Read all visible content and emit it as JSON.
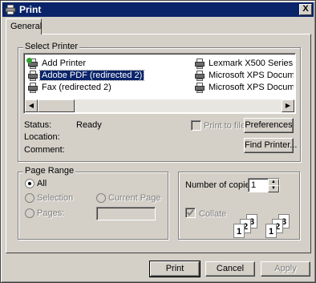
{
  "window": {
    "title": "Print",
    "close_label": "X"
  },
  "tabs": [
    {
      "label": "General"
    }
  ],
  "select_printer": {
    "label": "Select Printer",
    "printers": [
      {
        "name": "Add Printer",
        "icon": "add-printer-icon"
      },
      {
        "name": "Adobe PDF (redirected 2)",
        "icon": "printer-icon",
        "selected": true
      },
      {
        "name": "Fax (redirected 2)",
        "icon": "fax-icon"
      },
      {
        "name": "Lexmark X500 Series",
        "icon": "printer-icon"
      },
      {
        "name": "Microsoft XPS Document W",
        "icon": "printer-icon"
      },
      {
        "name": "Microsoft XPS Document W",
        "icon": "printer-icon"
      }
    ],
    "status_label": "Status:",
    "status_value": "Ready",
    "location_label": "Location:",
    "location_value": "",
    "comment_label": "Comment:",
    "comment_value": "",
    "print_to_file_label": "Print to file",
    "preferences_label": "Preferences",
    "find_printer_label": "Find Printer..."
  },
  "page_range": {
    "label": "Page Range",
    "all_label": "All",
    "selection_label": "Selection",
    "current_page_label": "Current Page",
    "pages_label": "Pages:",
    "pages_value": ""
  },
  "copies": {
    "label": "Number of copies:",
    "value": "1",
    "collate_label": "Collate",
    "collate_icon": "collate-icon",
    "sheet_numbers": [
      "1",
      "2",
      "3"
    ]
  },
  "buttons": {
    "print": "Print",
    "cancel": "Cancel",
    "apply": "Apply"
  }
}
